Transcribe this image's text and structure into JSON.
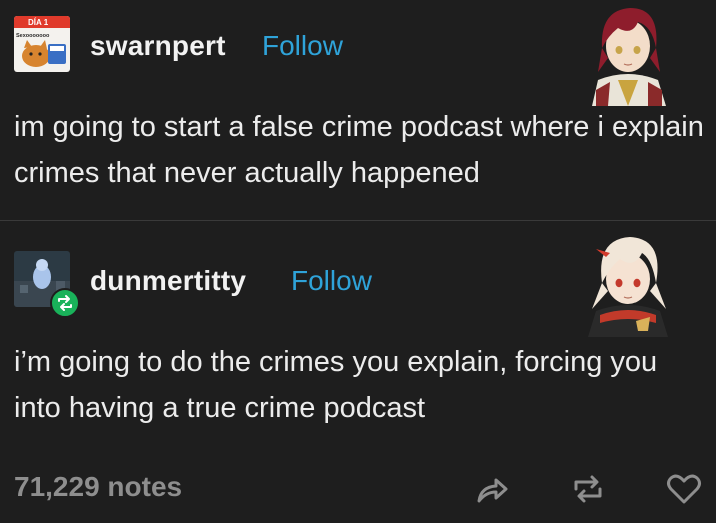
{
  "post1": {
    "username": "swarnpert",
    "follow_label": "Follow",
    "text": "im going to start a false crime podcast where i explain crimes that never actually happened",
    "avatar_calendar_top": "DÍA 1",
    "avatar_calendar_sub": "Sexooooooo"
  },
  "post2": {
    "username": "dunmertitty",
    "follow_label": "Follow",
    "text": "i’m going to do the crimes you explain, forcing you into having a true crime podcast"
  },
  "footer": {
    "notes": "71,229 notes"
  },
  "icons": {
    "share": "share-icon",
    "reblog": "reblog-icon",
    "like": "heart-icon",
    "reblog_badge": "reblog-badge-icon"
  },
  "colors": {
    "background": "#1e1e1e",
    "follow": "#2fa3d9",
    "notes": "#8e8e8e",
    "reblog_badge": "#19b25a"
  }
}
